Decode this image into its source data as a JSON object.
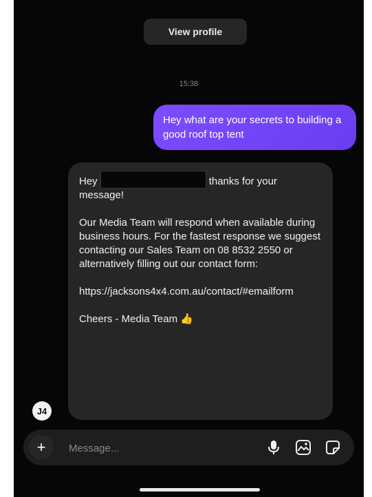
{
  "header": {
    "view_profile_label": "View profile"
  },
  "thread": {
    "timestamp": "15:38",
    "outgoing_message": "Hey what are your secrets to building a good roof top tent",
    "incoming": {
      "greeting_start": "Hey",
      "greeting_end": "thanks for your message!",
      "body": "Our Media Team will respond when available during business hours. For the fastest response we suggest contacting our Sales Team on 08 8532 2550 or alternatively filling out our contact form:",
      "link": "https://jacksons4x4.com.au/contact/#emailform",
      "signoff": "Cheers - Media Team 👍"
    },
    "avatar_initials": "J4"
  },
  "composer": {
    "placeholder": "Message...",
    "icons": [
      "plus-icon",
      "microphone-icon",
      "gallery-icon",
      "sticker-icon"
    ]
  },
  "colors": {
    "outgoing_bubble": "#7b4dff",
    "incoming_bubble": "#262626",
    "background": "#060606"
  }
}
